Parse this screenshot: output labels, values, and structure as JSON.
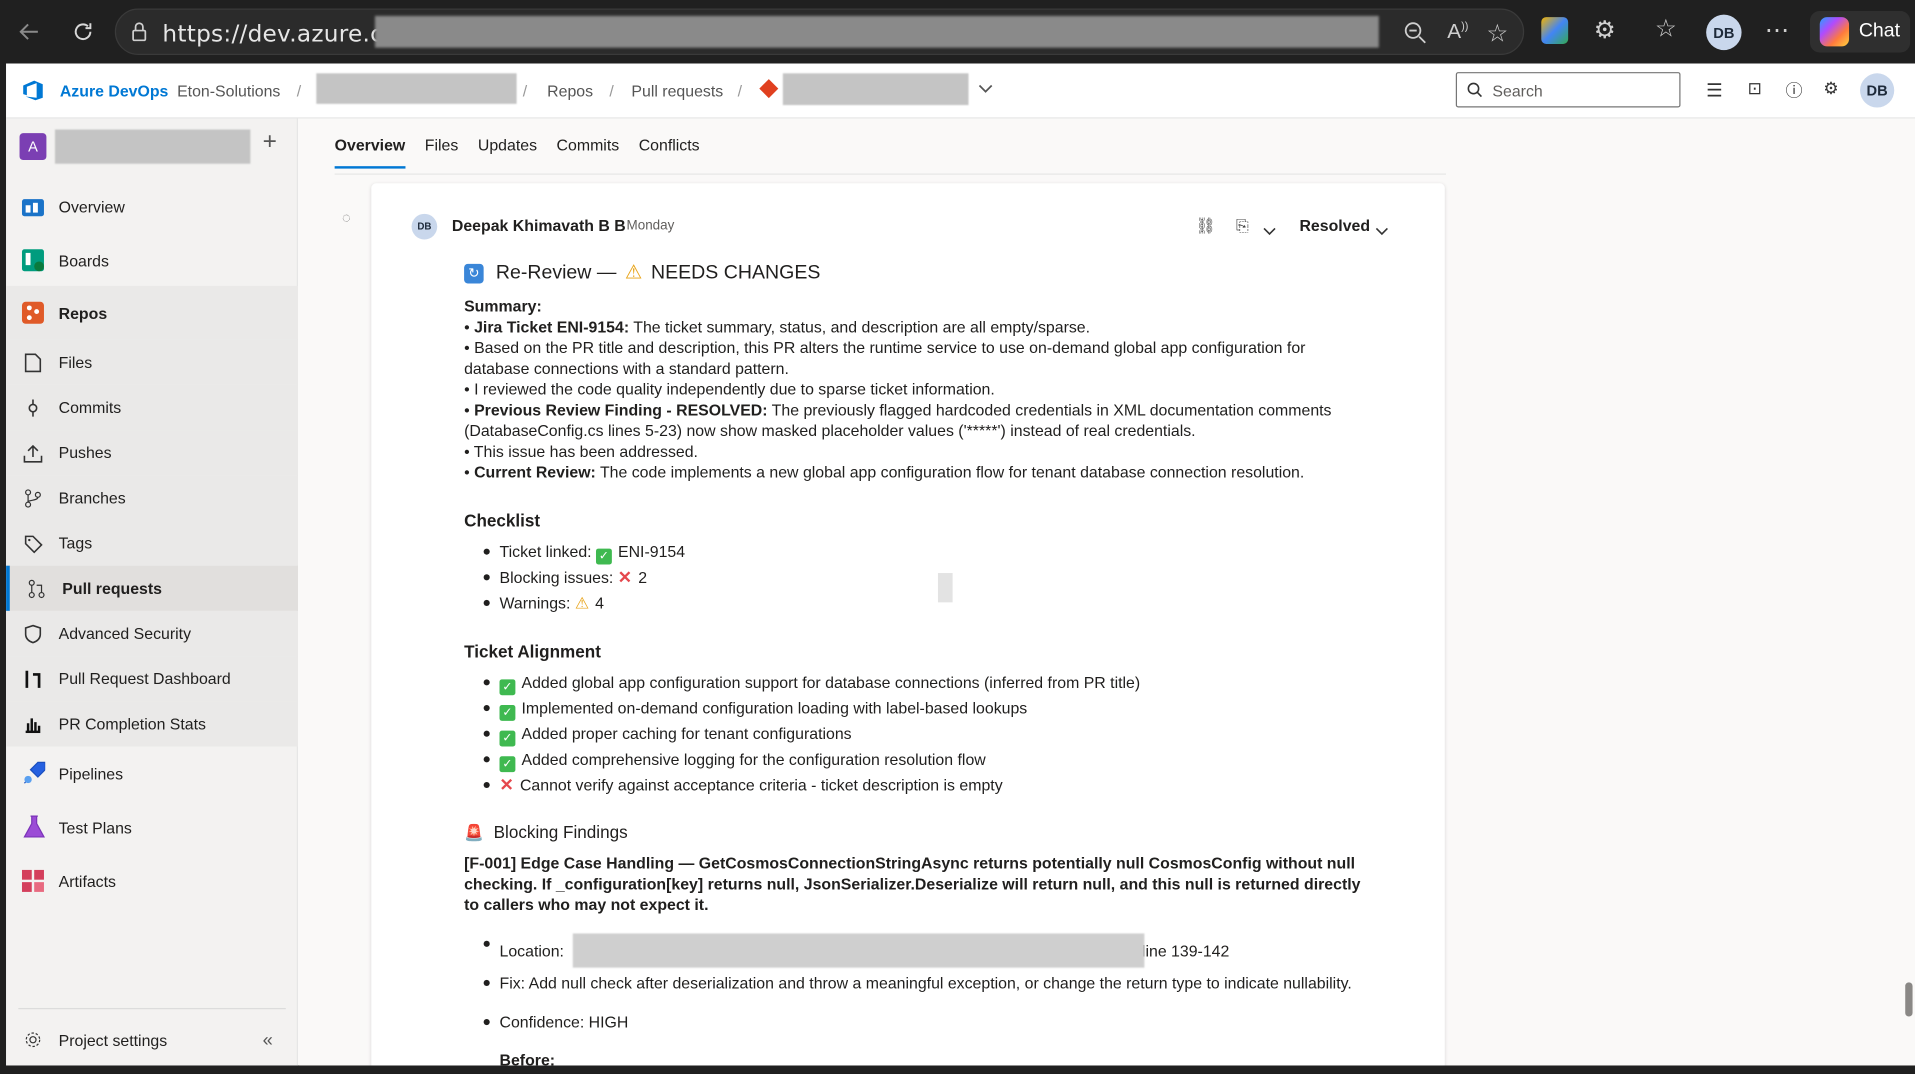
{
  "browser": {
    "url_prefix": "https://dev.azure.com/",
    "profile_initials": "DB",
    "chat_label": "Chat"
  },
  "topbar": {
    "brand": "Azure DevOps",
    "org": "Eton-Solutions",
    "sep": "/",
    "crumb_repos": "Repos",
    "crumb_prs": "Pull requests",
    "search_placeholder": "Search",
    "user_initials": "DB"
  },
  "sidebar": {
    "project_initial": "A",
    "items": [
      {
        "label": "Overview"
      },
      {
        "label": "Boards"
      },
      {
        "label": "Repos"
      },
      {
        "label": "Files"
      },
      {
        "label": "Commits"
      },
      {
        "label": "Pushes"
      },
      {
        "label": "Branches"
      },
      {
        "label": "Tags"
      },
      {
        "label": "Pull requests"
      },
      {
        "label": "Advanced Security"
      },
      {
        "label": "Pull Request Dashboard"
      },
      {
        "label": "PR Completion Stats"
      },
      {
        "label": "Pipelines"
      },
      {
        "label": "Test Plans"
      },
      {
        "label": "Artifacts"
      }
    ],
    "settings": "Project settings"
  },
  "tabs": [
    "Overview",
    "Files",
    "Updates",
    "Commits",
    "Conflicts"
  ],
  "comment": {
    "author_initials": "DB",
    "author": "Deepak Khimavath B B",
    "time": "Monday",
    "status": "Resolved",
    "heading_pre": "Re-Review —",
    "heading_post": "NEEDS CHANGES",
    "summary_label": "Summary:",
    "summary": [
      {
        "bold": "Jira Ticket ENI-9154:",
        "text": " The ticket summary, status, and description are all empty/sparse."
      },
      {
        "bold": "",
        "text": "Based on the PR title and description, this PR alters the runtime service to use on-demand global app configuration for database connections with a standard pattern."
      },
      {
        "bold": "",
        "text": "I reviewed the code quality independently due to sparse ticket information."
      },
      {
        "bold": "Previous Review Finding - RESOLVED:",
        "text": " The previously flagged hardcoded credentials in XML documentation comments (DatabaseConfig.cs lines 5-23) now show masked placeholder values ('*****') instead of real credentials."
      },
      {
        "bold": "",
        "text": "This issue has been addressed."
      },
      {
        "bold": "Current Review:",
        "text": " The code implements a new global app configuration flow for tenant database connection resolution."
      }
    ],
    "checklist_title": "Checklist",
    "checklist": [
      {
        "label": "Ticket linked:",
        "icon": "check",
        "value": "ENI-9154"
      },
      {
        "label": "Blocking issues:",
        "icon": "cross",
        "value": "2"
      },
      {
        "label": "Warnings:",
        "icon": "warning",
        "value": "4"
      }
    ],
    "alignment_title": "Ticket Alignment",
    "alignment": [
      {
        "icon": "check",
        "text": "Added global app configuration support for database connections (inferred from PR title)"
      },
      {
        "icon": "check",
        "text": "Implemented on-demand configuration loading with label-based lookups"
      },
      {
        "icon": "check",
        "text": "Added proper caching for tenant configurations"
      },
      {
        "icon": "check",
        "text": "Added comprehensive logging for the configuration resolution flow"
      },
      {
        "icon": "cross",
        "text": "Cannot verify against acceptance criteria - ticket description is empty"
      }
    ],
    "blocking_title": "Blocking Findings",
    "finding_title": "[F-001] Edge Case Handling — GetCosmosConnectionStringAsync returns potentially null CosmosConfig without null checking. If _configuration[key] returns null, JsonSerializer.Deserialize will return null, and this null is returned directly to callers who may not expect it.",
    "location_label": "Location:",
    "location_suffix": "line 139-142",
    "fix": "Fix: Add null check after deserialization and throw a meaningful exception, or change the return type to indicate nullability.",
    "confidence": "Confidence: HIGH",
    "before": "Before:"
  }
}
